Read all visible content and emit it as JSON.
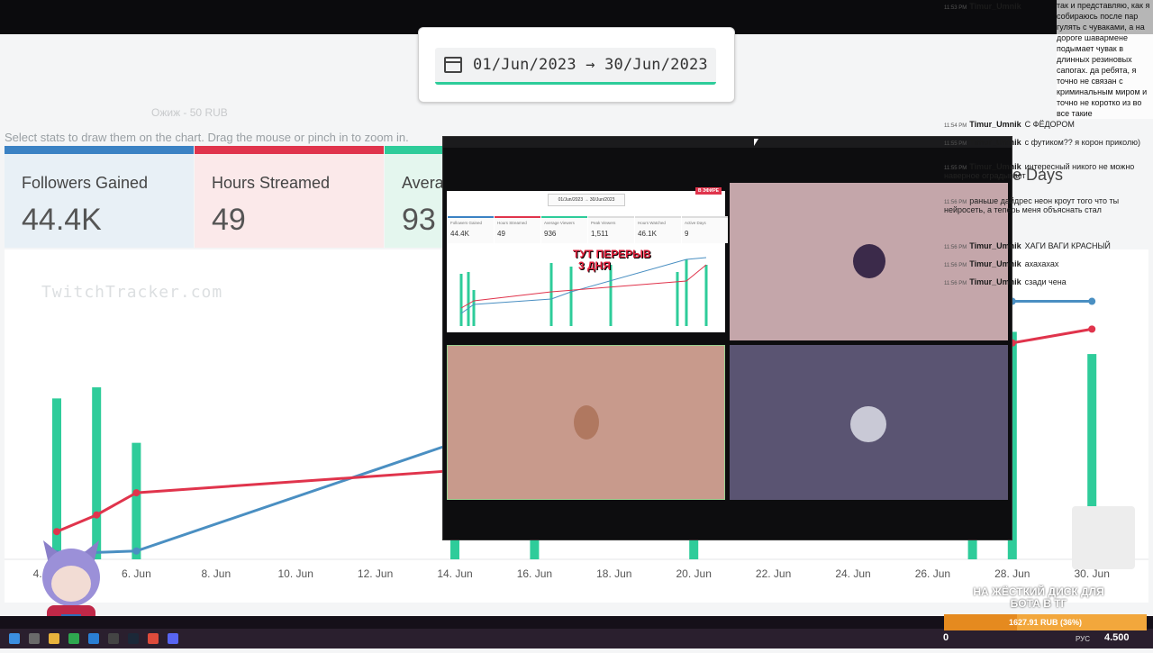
{
  "date_range": "01/Jun/2023 → 30/Jun/2023",
  "faint_overlay_text": "Ожиж - 50 RUB",
  "hint_text": "Select stats to draw them on the chart. Drag the mouse or pinch in to zoom in.",
  "stat_cards": [
    {
      "label": "Followers Gained",
      "value": "44.4K"
    },
    {
      "label": "Hours Streamed",
      "value": "49"
    },
    {
      "label": "Avera",
      "value": "93"
    }
  ],
  "hidden_card_label": "e Days",
  "watermark": "TwitchTracker.com",
  "chart_data": {
    "type": "bar",
    "x_ticks": [
      "4. Jun",
      "6. Jun",
      "8. Jun",
      "10. Jun",
      "12. Jun",
      "14. Jun",
      "16. Jun",
      "18. Jun",
      "20. Jun",
      "22. Jun",
      "24. Jun",
      "26. Jun",
      "28. Jun",
      "30. Jun"
    ],
    "bars_days": [
      4,
      5,
      6,
      14,
      16,
      20,
      27,
      28,
      30
    ],
    "bars_values": [
      0.58,
      0.62,
      0.42,
      0.1,
      0.1,
      0.1,
      0.1,
      0.82,
      0.74
    ],
    "line_followers": [
      [
        4,
        0.02
      ],
      [
        6,
        0.03
      ],
      [
        14,
        0.42
      ],
      [
        28,
        0.93
      ],
      [
        30,
        0.93
      ]
    ],
    "line_hours": [
      [
        4,
        0.1
      ],
      [
        5,
        0.16
      ],
      [
        6,
        0.24
      ],
      [
        14,
        0.32
      ],
      [
        28,
        0.78
      ],
      [
        30,
        0.83
      ]
    ],
    "colors": {
      "bars": "#2ecc9a",
      "followers": "#4a8fc2",
      "hours": "#e0344c"
    }
  },
  "overlay": {
    "mini_date": "01/Jun/2023 → 30/Jun/2023",
    "badge": "В ЭФИРЕ",
    "mini_cards": [
      {
        "label": "Followers Gained",
        "value": "44.4K"
      },
      {
        "label": "Hours Streamed",
        "value": "49"
      },
      {
        "label": "Average Viewers",
        "value": "936"
      },
      {
        "label": "Peak Viewers",
        "value": "1,511"
      },
      {
        "label": "Hours Watched",
        "value": "46.1K"
      },
      {
        "label": "Active Days",
        "value": "9"
      }
    ],
    "pause_line1": "ТУТ ПЕРЕРЫВ",
    "pause_line2": "3 ДНЯ"
  },
  "chat": {
    "long_text": "так и представляю, как я собираюсь после пар гулять с чуваками, а на дороге шавармене подымает чувак в длинных резиновых сапогах. да ребята, я точно не связан с криминальным миром и точно не коротко из во все такие",
    "messages": [
      {
        "time": "11:53 PM",
        "user": "Timur_Umnik",
        "text": ""
      },
      {
        "time": "11:54 PM",
        "user": "Timur_Umnik",
        "text": "С ФЁДОРОМ"
      },
      {
        "time": "11:55 PM",
        "user": "Timur_Umnik",
        "text": "с футиком?? я корон приколю)"
      },
      {
        "time": "11:55 PM",
        "user": "Timur_Umnik",
        "text": "интересный никого не можно наверное оградывает"
      },
      {
        "time": "11:56 PM",
        "user": "",
        "text": "раньше дайдрес неон кроут того что ты нейросеть, а теперь меня объяснать стал"
      },
      {
        "time": "11:56 PM",
        "user": "Timur_Umnik",
        "text": "ХАГИ ВАГИ КРАСНЫЙ"
      },
      {
        "time": "11:56 PM",
        "user": "Timur_Umnik",
        "text": "ахахахах"
      },
      {
        "time": "11:56 PM",
        "user": "Timur_Umnik",
        "text": "сзади чена"
      }
    ]
  },
  "goal_text": "НА ЖЁСТКИЙ ДИСК ДЛЯ БОТА В ТГ",
  "donation_text": "1627.91 RUB (36%)",
  "donation_progress": 0.36,
  "counter_left": "0",
  "counter_right": "4.500",
  "taskbar_lang": "РУС"
}
